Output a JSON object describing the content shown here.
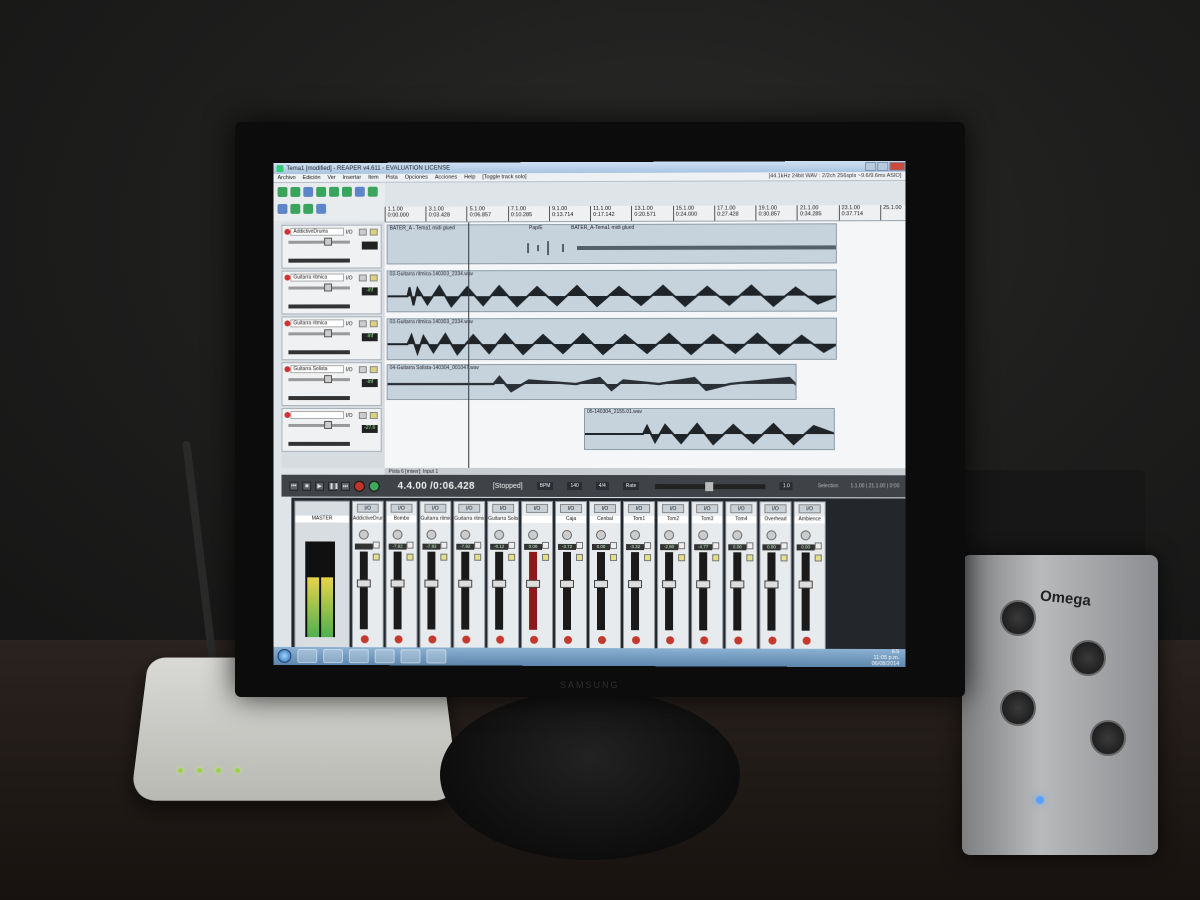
{
  "window": {
    "title": "Tema1 [modified] - REAPER v4.611 - EVALUATION LICENSE",
    "status_right": "[44.1kHz 24bit WAV : 2/2ch 256spls ~9.6/9.6ms ASIO]"
  },
  "menu": [
    "Archivo",
    "Edición",
    "Ver",
    "Insertar",
    "Item",
    "Pista",
    "Opciones",
    "Acciones",
    "Help",
    "[Toggle track solo]"
  ],
  "ruler": [
    {
      "bar": "1.1.00",
      "time": "0:00.000"
    },
    {
      "bar": "3.1.00",
      "time": "0:03.428"
    },
    {
      "bar": "5.1.00",
      "time": "0:06.857"
    },
    {
      "bar": "7.1.00",
      "time": "0:10.285"
    },
    {
      "bar": "9.1.00",
      "time": "0:13.714"
    },
    {
      "bar": "11.1.00",
      "time": "0:17.142"
    },
    {
      "bar": "13.1.00",
      "time": "0:20.571"
    },
    {
      "bar": "15.1.00",
      "time": "0:24.000"
    },
    {
      "bar": "17.1.00",
      "time": "0:27.428"
    },
    {
      "bar": "19.1.00",
      "time": "0:30.857"
    },
    {
      "bar": "21.1.00",
      "time": "0:34.285"
    },
    {
      "bar": "23.1.00",
      "time": "0:37.714"
    },
    {
      "bar": "25.1.00",
      "time": ""
    }
  ],
  "tracks": [
    {
      "name": "AddictiveDrums",
      "io": "I/O",
      "vol": "",
      "color": "#c33"
    },
    {
      "name": "Guitarra ritmica",
      "io": "I/O",
      "vol": "-inf",
      "color": "#c33"
    },
    {
      "name": "Guitarra ritmica",
      "io": "I/O",
      "vol": "-inf",
      "color": "#c33"
    },
    {
      "name": "Guitarra Solista",
      "io": "I/O",
      "vol": "-inf",
      "color": "#c33"
    },
    {
      "name": "",
      "io": "I/O",
      "vol": "-27.6",
      "color": "#c33"
    }
  ],
  "items": [
    {
      "name": "BATER_A - Tema1 midi glued",
      "second": "Pap/E",
      "third": "BATER_A-Tema1 midi glued"
    },
    {
      "name": "03-Guitarra ritmica-140303_2334.wav"
    },
    {
      "name": "03-Guitarra ritmica-140303_2334.wav"
    },
    {
      "name": "04-Guitarra Solista-140304_001047.wav"
    },
    {
      "name": "05-140304_2155.01.wav"
    }
  ],
  "status_bar": "Pista 6 [mixer]: Input 1",
  "transport": {
    "position": "4.4.00 /0:06.428",
    "state": "[Stopped]",
    "bpm_label": "BPM",
    "bpm": "140",
    "sig": "4/4",
    "rate_label": "Rate",
    "rate": "1.0",
    "selection_label": "Selection",
    "selection": "1.1.00 | 21.1.00 | 0:00"
  },
  "mixer": {
    "master_label": "MASTER",
    "strips": [
      {
        "name": "AddictiveDrums",
        "io": "I/O",
        "vol": "",
        "red": false
      },
      {
        "name": "Bombo",
        "io": "I/O",
        "vol": "-7.92",
        "red": false
      },
      {
        "name": "Guitarra ritmic",
        "io": "I/O",
        "vol": "-7.92",
        "red": false
      },
      {
        "name": "Guitarra ritmic",
        "io": "I/O",
        "vol": "-7.92",
        "red": false
      },
      {
        "name": "Guitarra Solista",
        "io": "I/O",
        "vol": "-8.12",
        "red": false
      },
      {
        "name": "",
        "io": "I/O",
        "vol": "0.00",
        "red": true
      },
      {
        "name": "Caja",
        "io": "I/O",
        "vol": "-3.72",
        "red": false
      },
      {
        "name": "Cenbal",
        "io": "I/O",
        "vol": "0.00",
        "red": false
      },
      {
        "name": "Tom1",
        "io": "I/O",
        "vol": "-3.32",
        "red": false
      },
      {
        "name": "Tom2",
        "io": "I/O",
        "vol": "-2.80",
        "red": false
      },
      {
        "name": "Tom3",
        "io": "I/O",
        "vol": "-4.77",
        "red": false
      },
      {
        "name": "Tom4",
        "io": "I/O",
        "vol": "0.00",
        "red": false
      },
      {
        "name": "Overhead",
        "io": "I/O",
        "vol": "0.00",
        "red": false
      },
      {
        "name": "Ambience",
        "io": "I/O",
        "vol": "0.00",
        "red": false
      }
    ]
  },
  "taskbar": {
    "time": "11:05 p.m.",
    "date": "06/08/2014",
    "lang": "ES"
  },
  "hardware": {
    "interface_brand": "Omega",
    "monitor_brand": "SAMSUNG"
  }
}
